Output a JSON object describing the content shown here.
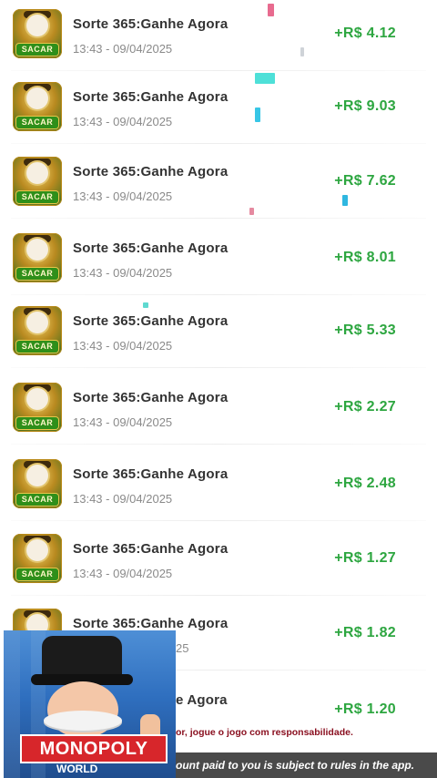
{
  "transactions": [
    {
      "title": "Sorte 365:Ganhe Agora",
      "datetime": "13:43 - 09/04/2025",
      "amount": "+R$ 4.12"
    },
    {
      "title": "Sorte 365:Ganhe Agora",
      "datetime": "13:43 - 09/04/2025",
      "amount": "+R$ 9.03"
    },
    {
      "title": "Sorte 365:Ganhe Agora",
      "datetime": "13:43 - 09/04/2025",
      "amount": "+R$ 7.62"
    },
    {
      "title": "Sorte 365:Ganhe Agora",
      "datetime": "13:43 - 09/04/2025",
      "amount": "+R$ 8.01"
    },
    {
      "title": "Sorte 365:Ganhe Agora",
      "datetime": "13:43 - 09/04/2025",
      "amount": "+R$ 5.33"
    },
    {
      "title": "Sorte 365:Ganhe Agora",
      "datetime": "13:43 - 09/04/2025",
      "amount": "+R$ 2.27"
    },
    {
      "title": "Sorte 365:Ganhe Agora",
      "datetime": "13:43 - 09/04/2025",
      "amount": "+R$ 2.48"
    },
    {
      "title": "Sorte 365:Ganhe Agora",
      "datetime": "13:43 - 09/04/2025",
      "amount": "+R$ 1.27"
    },
    {
      "title": "Sorte 365:Ganhe Agora",
      "datetime": "25",
      "amount": "+R$ 1.82"
    },
    {
      "title": "e Agora",
      "datetime": "",
      "amount": "+R$ 1.20"
    }
  ],
  "app_icon": {
    "badge_label": "SACAR",
    "icon": "slot-game-app-icon"
  },
  "promo": {
    "brand": "MONOPOLY",
    "sub": "WORLD",
    "icon": "monopoly-mascot-ad"
  },
  "notice_text": "or, jogue o jogo com responsabilidade.",
  "disclaimer_text": "ount paid to you is subject to rules in the app.",
  "colors": {
    "amount": "#2da640",
    "title": "#333333",
    "date": "#8a8a8a",
    "brand_red": "#d7262b",
    "notice": "#8a1020"
  }
}
